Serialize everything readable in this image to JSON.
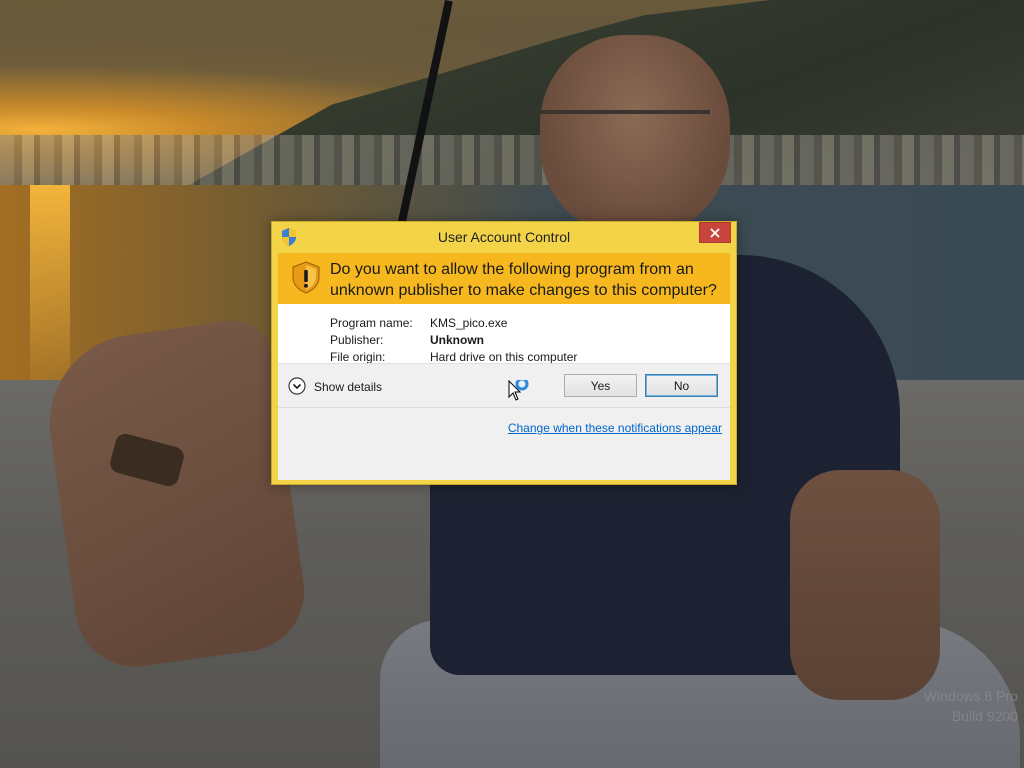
{
  "desktop": {
    "watermark_line1": "Windows 8 Pro",
    "watermark_line2": "Build 9200"
  },
  "dialog": {
    "title": "User Account Control",
    "question": "Do you want to allow the following program from an unknown publisher to make changes to this computer?",
    "fields": [
      {
        "label": "Program name:",
        "value": "KMS_pico.exe"
      },
      {
        "label": "Publisher:",
        "value": "Unknown"
      },
      {
        "label": "File origin:",
        "value": "Hard drive on this computer"
      }
    ],
    "show_details_label": "Show details",
    "yes_label": "Yes",
    "no_label": "No",
    "link_label": "Change when these notifications appear",
    "icons": {
      "title": "uac-shield-icon",
      "header": "warning-shield-icon",
      "close": "close-icon",
      "details": "chevron-down-icon"
    },
    "colors": {
      "frame": "#f3d449",
      "header": "#f6b81e",
      "close": "#c7453c",
      "link": "#0066cc"
    }
  }
}
